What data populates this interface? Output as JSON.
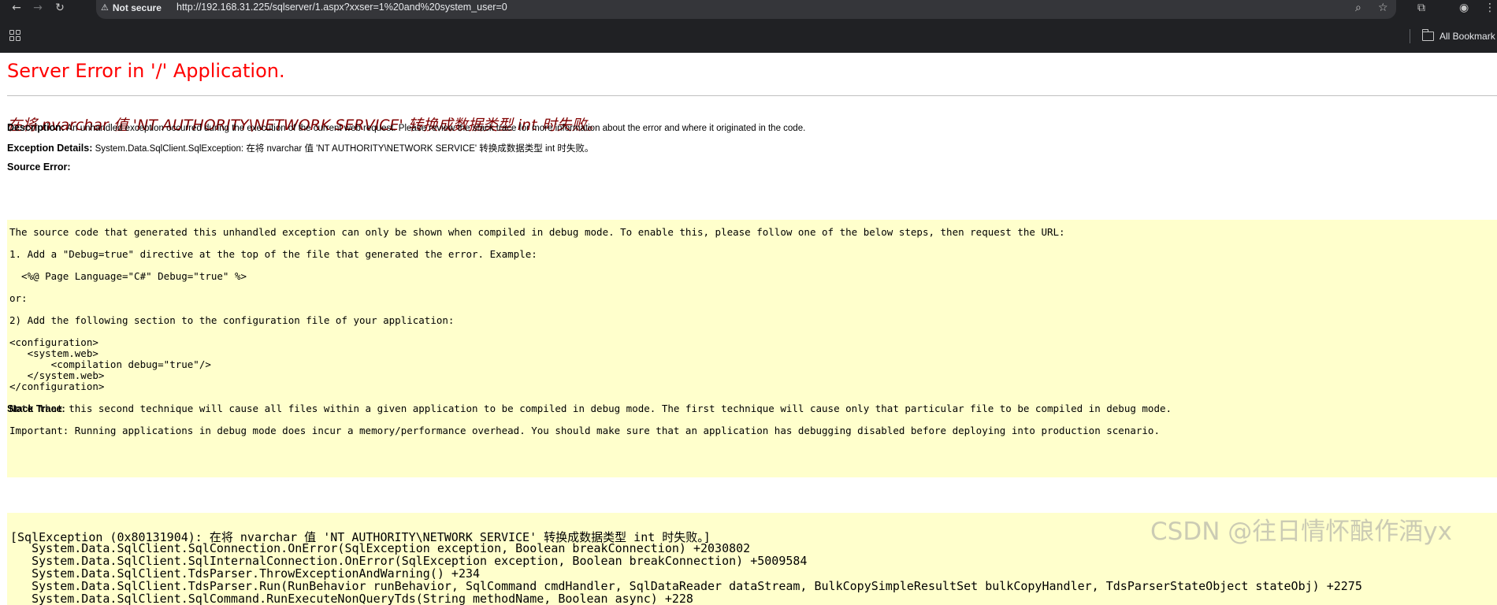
{
  "browser": {
    "security_label": "Not secure",
    "url": "http://192.168.31.225/sqlserver/1.aspx?xxser=1%20and%20system_user=0",
    "bookmarks_label": "All Bookmark"
  },
  "page": {
    "title": "Server Error in '/' Application.",
    "error_message": "在将 nvarchar 值 'NT AUTHORITY\\NETWORK SERVICE' 转换成数据类型 int 时失败。",
    "description_label": "Description:",
    "description_text": " An unhandled exception occurred during the execution of the current web request. Please review the stack trace for more information about the error and where it originated in the code.",
    "exception_label": "Exception Details:",
    "exception_text": " System.Data.SqlClient.SqlException: 在将 nvarchar 值 'NT AUTHORITY\\NETWORK SERVICE' 转换成数据类型 int 时失败。",
    "source_error_label": "Source Error:",
    "source_lines": [
      "The source code that generated this unhandled exception can only be shown when compiled in debug mode. To enable this, please follow one of the below steps, then request the URL:",
      "1. Add a \"Debug=true\" directive at the top of the file that generated the error. Example:",
      "  <%@ Page Language=\"C#\" Debug=\"true\" %>",
      "or:",
      "2) Add the following section to the configuration file of your application:",
      "<configuration>",
      "   <system.web>",
      "       <compilation debug=\"true\"/>",
      "   </system.web>",
      "</configuration>",
      "Note that this second technique will cause all files within a given application to be compiled in debug mode. The first technique will cause only that particular file to be compiled in debug mode.",
      "Important: Running applications in debug mode does incur a memory/performance overhead. You should make sure that an application has debugging disabled before deploying into production scenario."
    ],
    "stack_trace_label": "Stack Trace:",
    "stack_lines": [
      "[SqlException (0x80131904): 在将 nvarchar 值 'NT AUTHORITY\\NETWORK SERVICE' 转换成数据类型 int 时失败。]",
      "   System.Data.SqlClient.SqlConnection.OnError(SqlException exception, Boolean breakConnection) +2030802",
      "   System.Data.SqlClient.SqlInternalConnection.OnError(SqlException exception, Boolean breakConnection) +5009584",
      "   System.Data.SqlClient.TdsParser.ThrowExceptionAndWarning() +234",
      "   System.Data.SqlClient.TdsParser.Run(RunBehavior runBehavior, SqlCommand cmdHandler, SqlDataReader dataStream, BulkCopySimpleResultSet bulkCopyHandler, TdsParserStateObject stateObj) +2275",
      "   System.Data.SqlClient.SqlCommand.RunExecuteNonQueryTds(String methodName, Boolean async) +228"
    ]
  },
  "watermark": "CSDN @往日情怀酿作酒yx"
}
